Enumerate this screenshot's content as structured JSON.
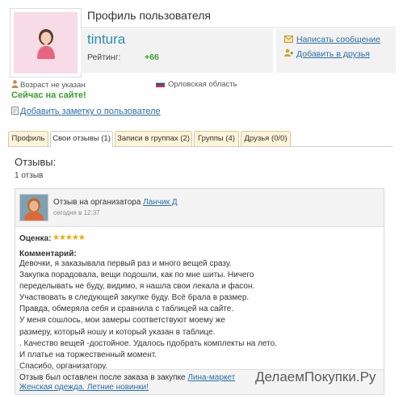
{
  "header": {
    "page_title": "Профиль пользователя",
    "username": "tintura",
    "rating_label": "Рейтинг:",
    "rating_value": "+66",
    "actions": {
      "send_message": "Написать сообщение",
      "add_friend": "Добавить в друзья"
    }
  },
  "meta": {
    "age": "Возраст не указан",
    "region": "Орловская область",
    "online_status": "Сейчас на сайте!",
    "add_note": "Добавить заметку о пользователе"
  },
  "tabs": [
    {
      "label": "Профиль"
    },
    {
      "label": "Свои отзывы (1)"
    },
    {
      "label": "Записи в группах (2)"
    },
    {
      "label": "Группы (4)"
    },
    {
      "label": "Друзья (0/0)"
    }
  ],
  "reviews": {
    "title": "Отзывы:",
    "count": "1 отзыв",
    "item": {
      "title_prefix": "Отзыв на организатора",
      "organizer": "Ланчик Д",
      "date": "сегодня в 12:37",
      "score_label": "Оценка:",
      "stars": 5,
      "comment_label": "Комментарий:",
      "comment_lines": [
        "Девочки, я заказывала первый раз и много вещей сразу.",
        "Закупка порадовала, вещи подошли, как по мне шиты. Ничего",
        "переделывать не буду, видимо, я нашла свои лекала и фасон.",
        "Участвовать в следующей закупке буду. Всё брала в размер.",
        "Правда, обмеряла себя и сравнила с таблицей на сайте.",
        "У меня сошлось, мои замеры соответствуют моему же",
        "размеру, который ношу и который указан в таблице.",
        ". Качество вещей -достойное. Удалось пдобрать комплекты на лето.",
        "И платье на торжественный момент.",
        "Спасибо, организатору."
      ],
      "footer_prefix": "Отзыв был оставлен после заказа в закупке",
      "footer_link": "Лина-маркет Женская одежда. Летние новинки!"
    }
  },
  "watermark": "ДелаемПокупки.Ру",
  "colors": {
    "accent_link": "#2a6fa8",
    "username": "#2a8fb5",
    "online_green": "#3aa02c",
    "tab_bg": "#fff4d8"
  }
}
